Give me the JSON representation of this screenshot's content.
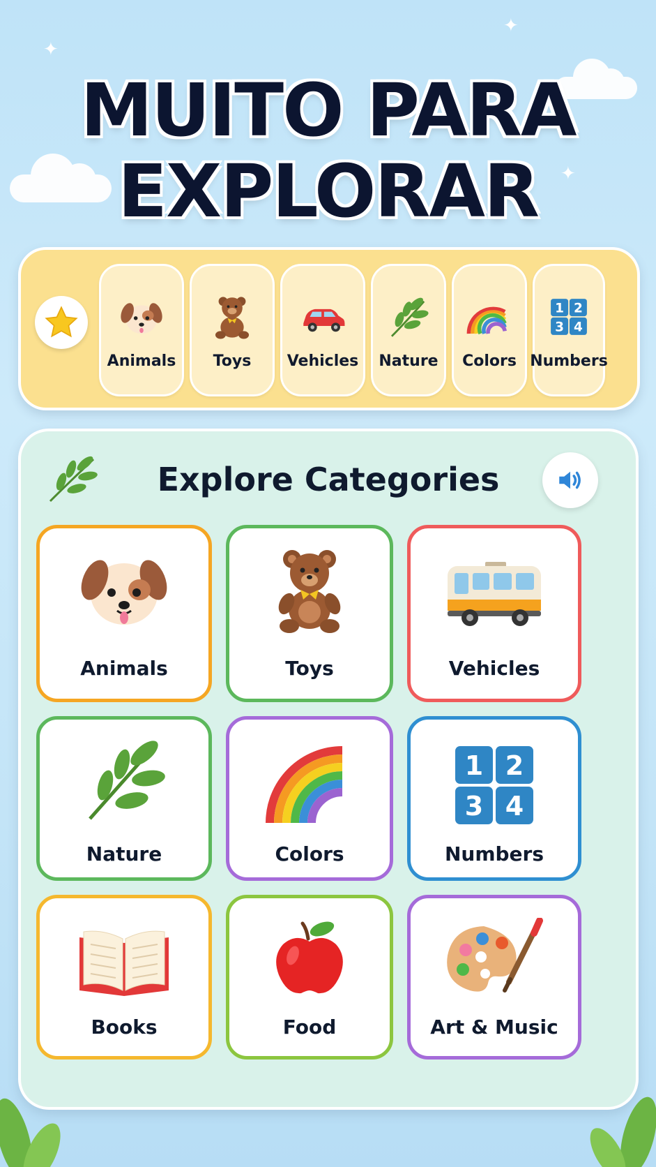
{
  "header": {
    "title_line1": "MUITO PARA",
    "title_line2": "EXPLORAR"
  },
  "tray": {
    "items": [
      {
        "label": "Animals",
        "icon": "dog-icon"
      },
      {
        "label": "Toys",
        "icon": "teddy-bear-icon"
      },
      {
        "label": "Vehicles",
        "icon": "car-icon"
      },
      {
        "label": "Nature",
        "icon": "leaf-icon"
      },
      {
        "label": "Colors",
        "icon": "rainbow-icon"
      },
      {
        "label": "Numbers",
        "icon": "numbers-icon"
      }
    ],
    "star_icon": "star-icon"
  },
  "panel": {
    "title": "Explore Categories",
    "categories": [
      {
        "label": "Animals",
        "icon": "dog-icon",
        "border": "#f5a623"
      },
      {
        "label": "Toys",
        "icon": "teddy-bear-icon",
        "border": "#5cb85c"
      },
      {
        "label": "Vehicles",
        "icon": "bus-icon",
        "border": "#ef5b5b"
      },
      {
        "label": "Nature",
        "icon": "leaf-icon",
        "border": "#5cb85c"
      },
      {
        "label": "Colors",
        "icon": "rainbow-icon",
        "border": "#a56bd9"
      },
      {
        "label": "Numbers",
        "icon": "numbers-icon",
        "border": "#2f8fd1"
      },
      {
        "label": "Books",
        "icon": "book-icon",
        "border": "#f5b82e"
      },
      {
        "label": "Food",
        "icon": "apple-icon",
        "border": "#8cc63f"
      },
      {
        "label": "Art & Music",
        "icon": "palette-icon",
        "border": "#a56bd9"
      }
    ]
  },
  "numbers_tile": [
    "1",
    "2",
    "3",
    "4"
  ]
}
